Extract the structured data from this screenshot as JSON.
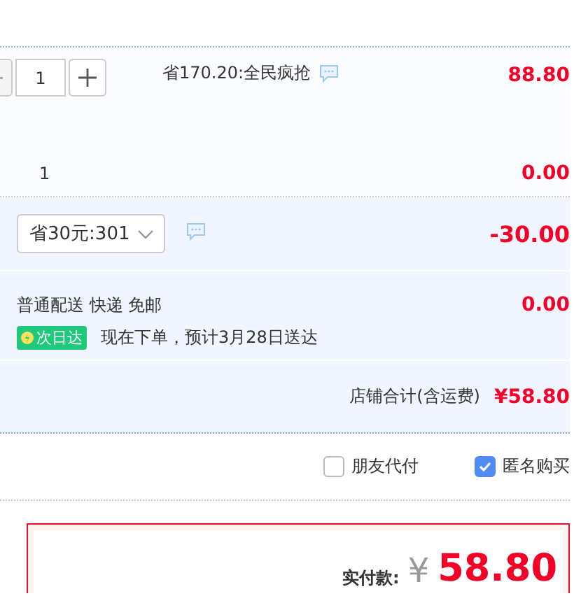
{
  "item": {
    "quantity": "1",
    "promo": "省170.20:全民疯抢",
    "price": "88.80",
    "sub_quantity": "1",
    "sub_price": "0.00"
  },
  "discount": {
    "selected_option": "省30元:301",
    "amount": "-30.00"
  },
  "shipping": {
    "method": "普通配送 快递 免邮",
    "badge": "次日达",
    "eta": "现在下单，预计3月28日送达",
    "fee": "0.00"
  },
  "store_total": {
    "label": "店铺合计(含运费)",
    "amount": "¥58.80"
  },
  "options": [
    {
      "label": "朋友代付",
      "checked": false
    },
    {
      "label": "匿名购买",
      "checked": true
    }
  ],
  "payment": {
    "label": "实付款:",
    "currency": "¥",
    "amount": "58.80"
  }
}
